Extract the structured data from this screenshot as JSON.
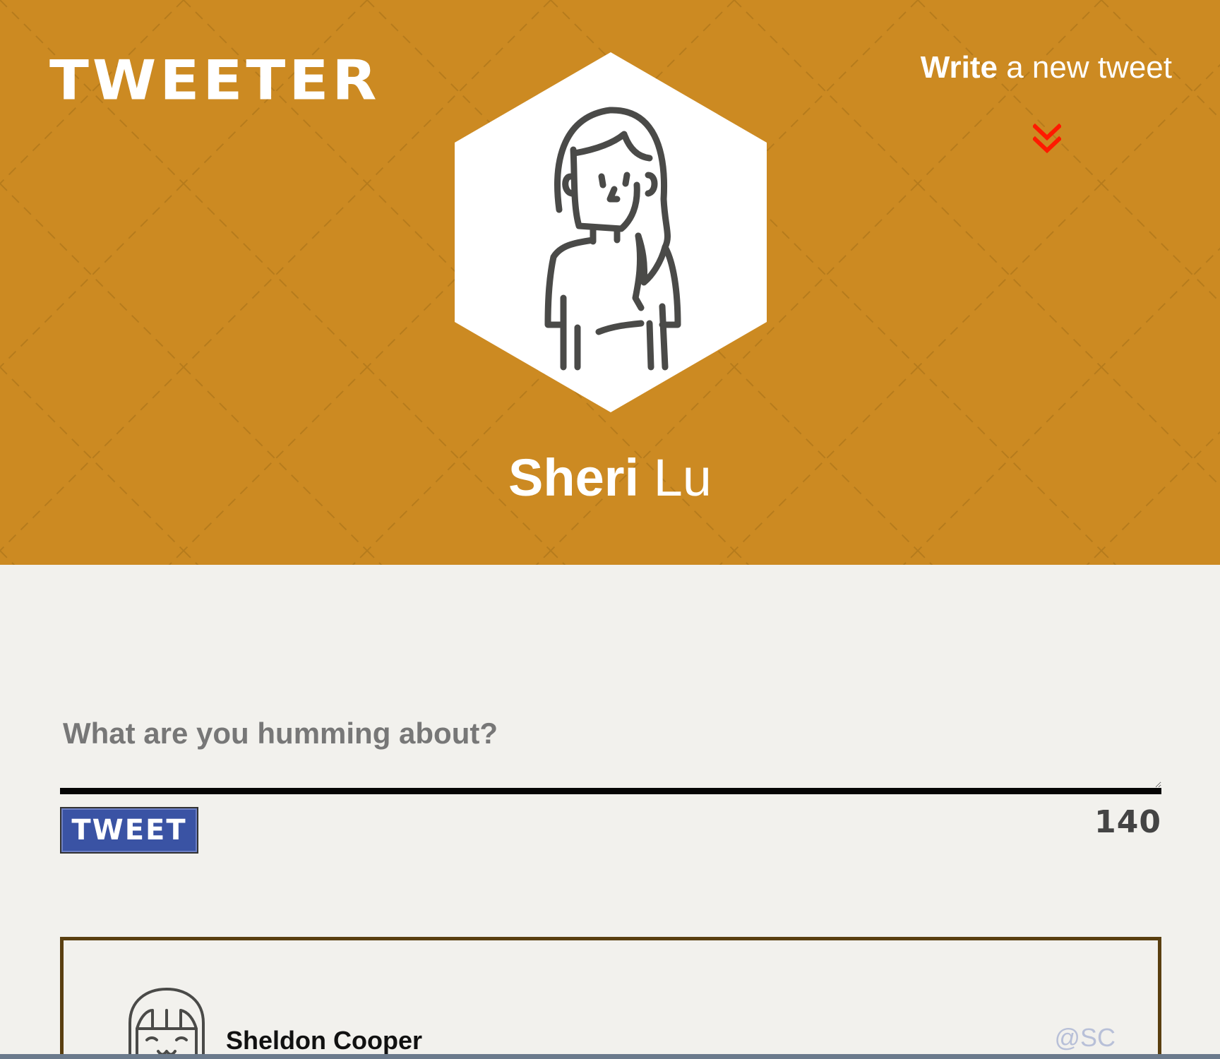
{
  "header": {
    "brand": "TWEETER",
    "write_link": {
      "bold": "Write",
      "rest": "a new tweet"
    },
    "colors": {
      "background": "#cc8a22",
      "chevron": "#ff1a00"
    },
    "icons": {
      "chevron": "double-chevron-down-icon",
      "avatar": "woman-avatar-icon"
    }
  },
  "profile": {
    "first_name": "Sheri",
    "last_name": "Lu"
  },
  "composer": {
    "placeholder": "What are you humming about?",
    "value": "",
    "button_label": "TWEET",
    "counter": "140",
    "colors": {
      "button": "#3a53a4"
    }
  },
  "tweets": [
    {
      "author": "Sheldon Cooper",
      "handle": "@SC",
      "avatar_icon": "girl-avatar-icon"
    }
  ]
}
